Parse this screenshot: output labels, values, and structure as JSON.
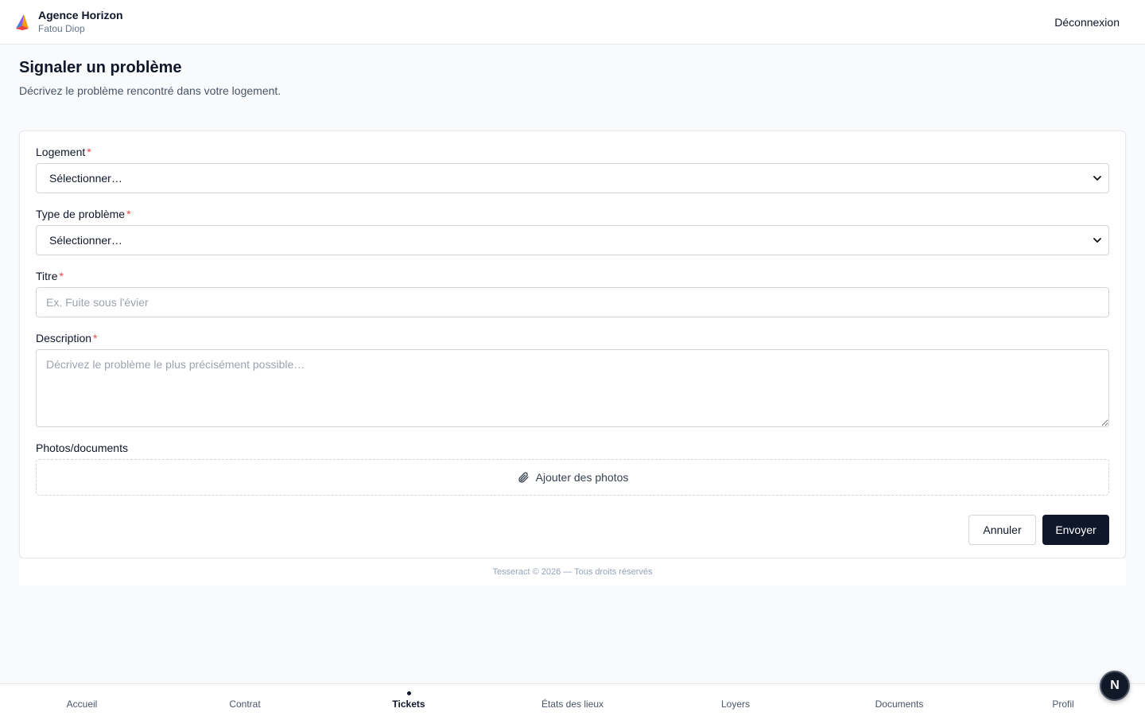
{
  "header": {
    "brand_name": "Agence Horizon",
    "user_name": "Fatou Diop",
    "logout_label": "Déconnexion"
  },
  "page": {
    "title": "Signaler un problème",
    "subtitle": "Décrivez le problème rencontré dans votre logement."
  },
  "form": {
    "logement": {
      "label": "Logement",
      "value": "Sélectionner…"
    },
    "type": {
      "label": "Type de problème",
      "value": "Sélectionner…"
    },
    "titre": {
      "label": "Titre",
      "placeholder": "Ex. Fuite sous l'évier"
    },
    "description": {
      "label": "Description",
      "placeholder": "Décrivez le problème le plus précisément possible…"
    },
    "photos": {
      "label": "Photos/documents",
      "button_label": "Ajouter des photos"
    },
    "required_mark": "*",
    "cancel_label": "Annuler",
    "submit_label": "Envoyer"
  },
  "footer": {
    "text": "Tesseract © 2026 — Tous droits réservés"
  },
  "bottom_nav": {
    "items": [
      {
        "label": "Accueil"
      },
      {
        "label": "Contrat"
      },
      {
        "label": "Tickets",
        "active": true
      },
      {
        "label": "États des lieux"
      },
      {
        "label": "Loyers"
      },
      {
        "label": "Documents"
      },
      {
        "label": "Profil"
      }
    ]
  },
  "fab": {
    "letter": "N"
  },
  "colors": {
    "primary": "#0f172a",
    "required": "#ef4444",
    "background": "#f8fafc",
    "border": "#d1d5db"
  }
}
